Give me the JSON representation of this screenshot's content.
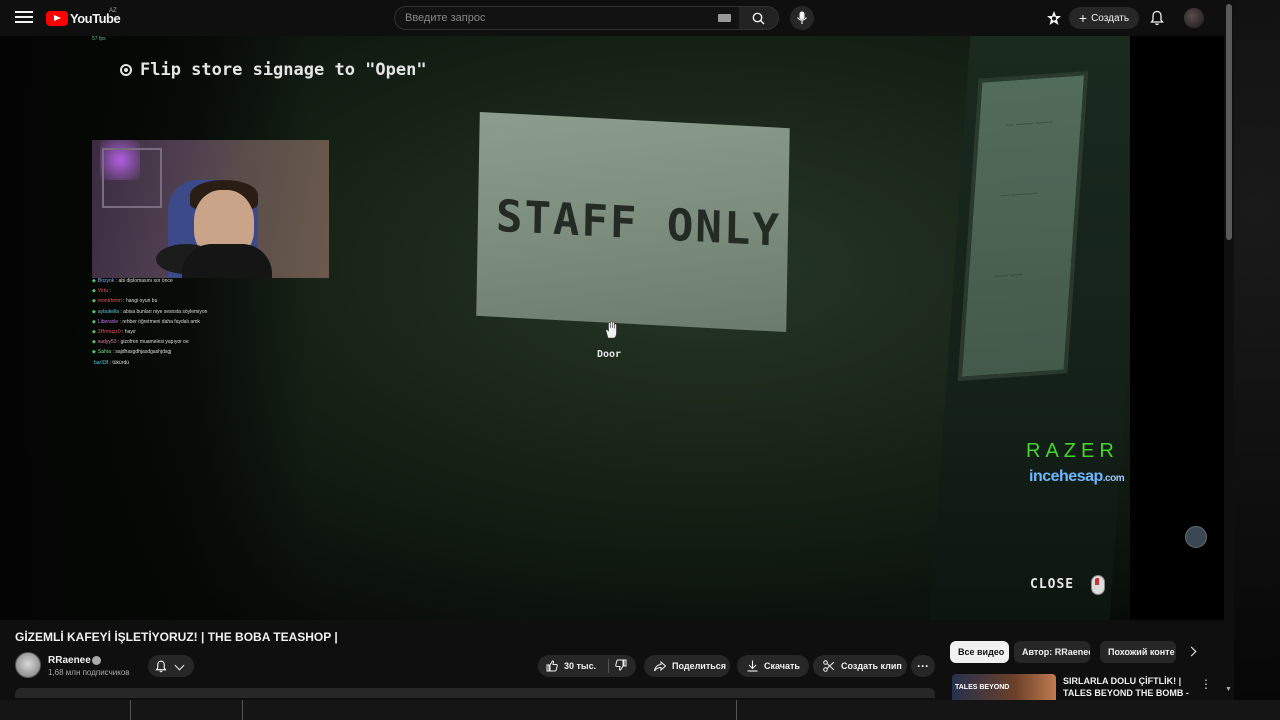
{
  "masthead": {
    "logo_text": "YouTube",
    "country_code": "AZ",
    "search_placeholder": "Введите запрос",
    "create_label": "Создать"
  },
  "player": {
    "fps_overlay": "57 fps",
    "objective_text": "Flip store signage to \"Open\"",
    "sign_text": "STAFF ONLY",
    "interact_label": "Door",
    "sponsor_brand": "RAZER",
    "sponsor_site_main": "incehesap",
    "sponsor_site_tld": ".com",
    "close_label": "CLOSE",
    "chat": [
      {
        "user": "Bozynk",
        "msg": "abi diplomasını sor önce"
      },
      {
        "user": "Virtu",
        "msg": ""
      },
      {
        "user": "montrhmm",
        "msg": "hangi oyun bu"
      },
      {
        "user": "aybukella",
        "msg": "abisa bunları niye sesnsta söylemiyon"
      },
      {
        "user": "Liberaxle",
        "msg": "rehber öğretmeni daha faydalı amk"
      },
      {
        "user": "3Hrmuzz0",
        "msg": "hayır"
      },
      {
        "user": "sudyy53",
        "msg": "gizofren muamelesi yapıyor oe"
      },
      {
        "user": "Sahra",
        "msg": "sajdhasgdhjasdgashjdsgj"
      },
      {
        "user": "bar33f",
        "msg": "tükürdü"
      }
    ]
  },
  "video": {
    "title": "GİZEMLİ KAFEYİ İŞLETİYORUZ! | THE BOBA TEASHOP |",
    "channel_name": "RRaenee",
    "subscribers": "1,68 млн подписчиков",
    "likes": "30 тыс.",
    "share_label": "Поделиться",
    "download_label": "Скачать",
    "clip_label": "Создать клип",
    "more_label": "···"
  },
  "sidebar": {
    "chips": [
      "Все видео",
      "Автор: RRaenee",
      "Похожий конте"
    ],
    "recommendation": {
      "thumb_text": "TALES BEYOND",
      "title": "SIRLARLA DOLU ÇİFTLİK! | TALES BEYOND THE BOMB -"
    }
  },
  "colors": {
    "background": "#0f0f0f",
    "brand_red": "#ff0000",
    "razer_green": "#44d62c",
    "incehesap_blue": "#6fb5ff"
  }
}
